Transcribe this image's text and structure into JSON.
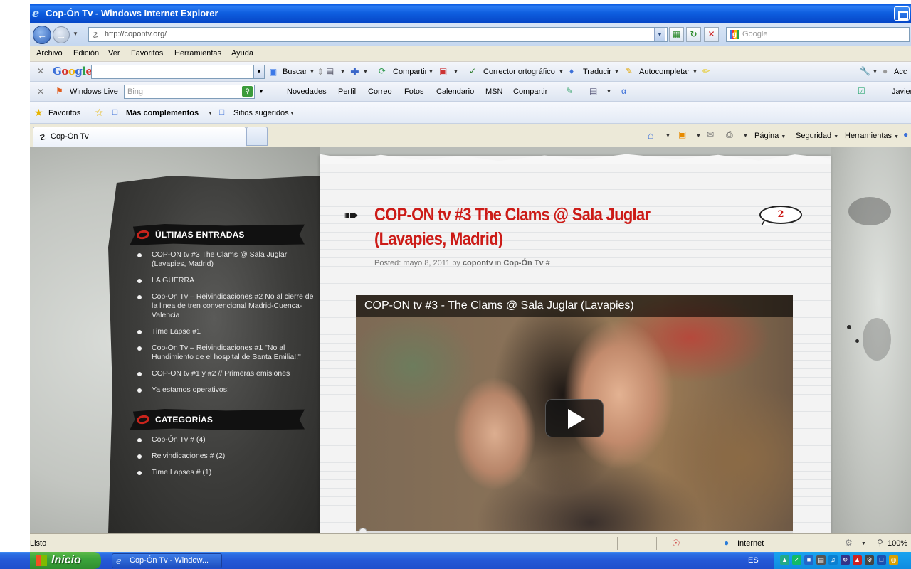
{
  "window": {
    "title": "Cop-Ón Tv - Windows Internet Explorer"
  },
  "address_bar": {
    "url": "http://copontv.org/",
    "search_placeholder": "Google"
  },
  "menu": {
    "items": [
      "Archivo",
      "Edición",
      "Ver",
      "Favoritos",
      "Herramientas",
      "Ayuda"
    ]
  },
  "google_toolbar": {
    "logo": "Google",
    "buscar": "Buscar",
    "compartir": "Compartir",
    "corrector": "Corrector ortográfico",
    "traducir": "Traducir",
    "autocompletar": "Autocompletar",
    "right_label": "Acc"
  },
  "live_toolbar": {
    "brand": "Windows Live",
    "search_placeholder": "Bing",
    "links": [
      "Novedades",
      "Perfil",
      "Correo",
      "Fotos",
      "Calendario",
      "MSN",
      "Compartir"
    ],
    "user": "Javier"
  },
  "favorites_bar": {
    "favoritos": "Favoritos",
    "mas_complementos": "Más complementos",
    "sitios_sugeridos": "Sitios sugeridos"
  },
  "tabs": {
    "active_tab": "Cop-Ón Tv",
    "right_tools": [
      "Página",
      "Seguridad",
      "Herramientas"
    ]
  },
  "sidebar": {
    "recent_heading": "ÚLTIMAS ENTRADAS",
    "recent_posts": [
      "COP-ON tv #3 The Clams @ Sala Juglar (Lavapies, Madrid)",
      "LA GUERRA",
      "Cop-On Tv – Reivindicaciones #2 No al cierre de la linea de tren convencional Madrid-Cuenca-Valencia",
      "Time Lapse #1",
      "Cop-Ón Tv – Reivindicaciones #1 \"No al Hundimiento de el hospital de Santa Emilia!!\"",
      "COP-ON tv #1 y #2 // Primeras emisiones",
      "Ya estamos operativos!"
    ],
    "categories_heading": "CATEGORÍAS",
    "categories": [
      "Cop-Ón Tv # (4)",
      "Reivindicaciones # (2)",
      "Time Lapses # (1)"
    ]
  },
  "post": {
    "title": "COP-ON tv #3 The Clams @ Sala Juglar (Lavapies, Madrid)",
    "comment_count": "2",
    "meta_prefix": "Posted: mayo 8, 2011 by",
    "author": "copontv",
    "meta_in": "in",
    "category": "Cop-Ón Tv #",
    "video_title": "COP-ON tv #3 - The Clams @ Sala Juglar (Lavapies)"
  },
  "status_bar": {
    "status": "Listo",
    "zone": "Internet",
    "zoom": "100%"
  },
  "taskbar": {
    "start": "Inicio",
    "task": "Cop-Ón Tv - Window...",
    "language": "ES"
  }
}
